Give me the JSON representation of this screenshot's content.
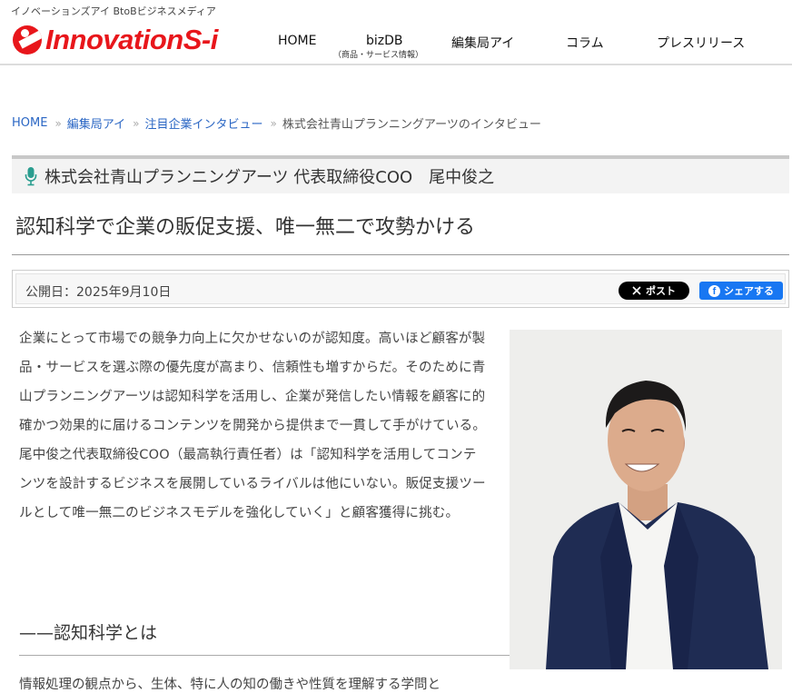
{
  "header": {
    "tagline": "イノベーションズアイ BtoBビジネスメディア",
    "logo_text": "InnovationS-i",
    "nav": [
      {
        "label": "HOME"
      },
      {
        "label": "bizDB",
        "sub": "（商品・サービス情報）"
      },
      {
        "label": "編集局アイ"
      },
      {
        "label": "コラム"
      },
      {
        "label": "プレスリリース"
      }
    ]
  },
  "breadcrumb": {
    "items": [
      "HOME",
      "編集局アイ",
      "注目企業インタビュー"
    ],
    "current": "株式会社青山プランニングアーツのインタビュー",
    "separator": "»"
  },
  "article": {
    "person": "株式会社青山プランニングアーツ 代表取締役COO　尾中俊之",
    "title": "認知科学で企業の販促支援、唯一無二で攻勢かける",
    "published": "公開日：2025年9月10日",
    "share_x": "ポスト",
    "share_fb": "シェアする",
    "lead": "企業にとって市場での競争力向上に欠かせないのが認知度。高いほど顧客が製品・サービスを選ぶ際の優先度が高まり、信頼性も増すからだ。そのために青山プランニングアーツは認知科学を活用し、企業が発信したい情報を顧客に的確かつ効果的に届けるコンテンツを開発から提供まで一貫して手がけている。尾中俊之代表取締役COO（最高執行責任者）は「認知科学を活用してコンテンツを設計するビジネスを展開しているライバルは他にいない。販促支援ツールとして唯一無二のビジネスモデルを強化していく」と顧客獲得に挑む。",
    "section_heading": "——認知科学とは",
    "body_start": "情報処理の観点から、生体、特に人の知の働きや性質を理解する学問と"
  },
  "colors": {
    "brand_red": "#e8161b",
    "link_blue": "#2a66c4",
    "mic_green": "#2a9d8f",
    "x_black": "#000000",
    "fb_blue": "#1877f2"
  },
  "icons": [
    "logo-icon",
    "microphone-icon",
    "x-logo-icon",
    "facebook-icon",
    "breadcrumb-separator-icon"
  ]
}
